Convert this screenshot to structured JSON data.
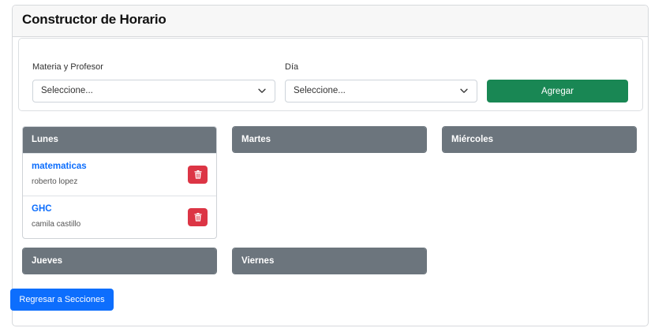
{
  "card": {
    "title": "Constructor de Horario"
  },
  "form": {
    "subject_label": "Materia y Profesor",
    "subject_value": "Seleccione...",
    "day_label": "Día",
    "day_value": "Seleccione...",
    "add_label": "Agregar"
  },
  "days": [
    {
      "name": "Lunes",
      "slots": [
        {
          "subject": "matematicas",
          "teacher": "roberto lopez"
        },
        {
          "subject": "GHC",
          "teacher": "camila castillo"
        }
      ]
    },
    {
      "name": "Martes",
      "slots": []
    },
    {
      "name": "Miércoles",
      "slots": []
    },
    {
      "name": "Jueves",
      "slots": []
    },
    {
      "name": "Viernes",
      "slots": []
    }
  ],
  "back_label": "Regresar a Secciones",
  "icons": {
    "select": "chevron-down-icon",
    "delete": "trash-icon"
  },
  "colors": {
    "add": "#198754",
    "back": "#0d6efd",
    "delete": "#dc3545",
    "day_header": "#6c757d",
    "subject": "#0d6efd"
  }
}
